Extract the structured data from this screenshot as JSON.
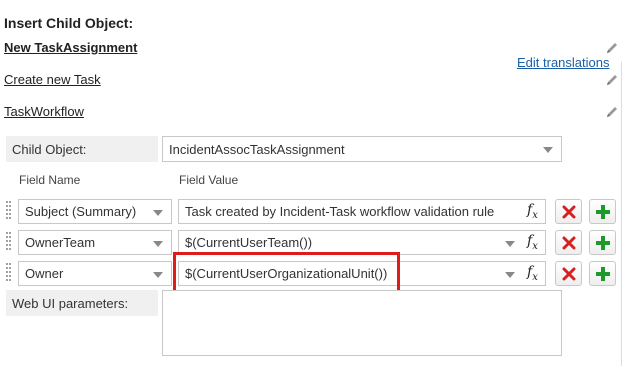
{
  "header": {
    "title": "Insert Child Object:",
    "links": [
      "New TaskAssignment",
      "Create new Task",
      "TaskWorkflow"
    ],
    "edit_translations": "Edit translations"
  },
  "child_object": {
    "label": "Child Object:",
    "value": "IncidentAssocTaskAssignment"
  },
  "columns": {
    "field_name": "Field Name",
    "field_value": "Field Value"
  },
  "rows": [
    {
      "field": "Subject (Summary)",
      "value": "Task created by Incident-Task workflow validation rule",
      "value_is_dropdown": false
    },
    {
      "field": "OwnerTeam",
      "value": "$(CurrentUserTeam())",
      "value_is_dropdown": true
    },
    {
      "field": "Owner",
      "value": "$(CurrentUserOrganizationalUnit())",
      "value_is_dropdown": true,
      "highlighted": true
    }
  ],
  "web_ui": {
    "label": "Web UI parameters:",
    "value": ""
  },
  "icons": {
    "edit": "pencil-icon",
    "formula": "fx-icon",
    "delete": "red-x-icon",
    "add": "green-plus-icon",
    "drag": "drag-handle-icon"
  },
  "colors": {
    "delete": "#d42020",
    "add": "#1e9a2a",
    "link": "#1a5fa8",
    "highlight": "#e01b1b"
  }
}
